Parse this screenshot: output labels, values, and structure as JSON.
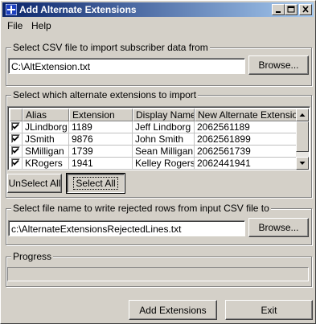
{
  "window": {
    "title": "Add Alternate Extensions",
    "accent": "#0a246a"
  },
  "menu": [
    "File",
    "Help"
  ],
  "csv_section": {
    "label": "Select CSV file to import subscriber data from",
    "path": "C:\\AltExtension.txt",
    "browse_label": "Browse..."
  },
  "import_section": {
    "label": "Select which alternate extensions to import",
    "columns": [
      "Alias",
      "Extension",
      "Display Name",
      "New Alternate Extension"
    ],
    "rows": [
      {
        "checked": true,
        "alias": "JLindborg",
        "extension": "1189",
        "display_name": "Jeff Lindborg",
        "new_ext": "2062561189"
      },
      {
        "checked": true,
        "alias": "JSmith",
        "extension": "9876",
        "display_name": "John Smith",
        "new_ext": "2062561899"
      },
      {
        "checked": true,
        "alias": "SMilligan",
        "extension": "1739",
        "display_name": "Sean Milligan",
        "new_ext": "2062561739"
      },
      {
        "checked": true,
        "alias": "KRogers",
        "extension": "1941",
        "display_name": "Kelley Rogers",
        "new_ext": "2062441941"
      }
    ],
    "unselect_all_label": "UnSelect All",
    "select_all_label": "Select All"
  },
  "rejected_section": {
    "label": "Select file name to write rejected rows from input CSV file to",
    "path": "c:\\AlternateExtensionsRejectedLines.txt",
    "browse_label": "Browse..."
  },
  "progress_section": {
    "label": "Progress",
    "value": 0
  },
  "footer": {
    "add_label": "Add Extensions",
    "exit_label": "Exit"
  }
}
